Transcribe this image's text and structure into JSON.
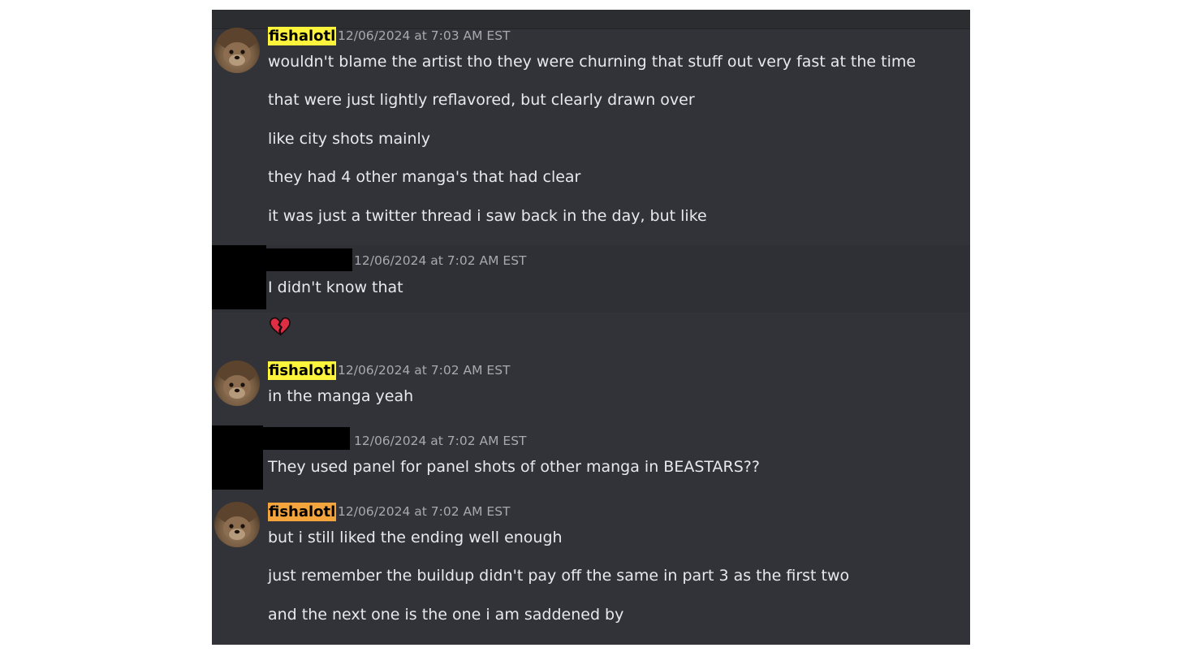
{
  "colors": {
    "background": "#313338",
    "highlight_yellow": "#fdf43b",
    "highlight_orange": "#f4a43c",
    "timestamp": "#a7a9ae",
    "message_text": "#e8e9ec",
    "redaction": "#000000"
  },
  "groups": [
    {
      "author": "fishalotl",
      "timestamp": "12/06/2024 at 7:03 AM EST",
      "messages": [
        "wouldn't blame the artist tho they were churning that stuff out very fast at the time",
        "that were just lightly reflavored, but clearly drawn over",
        "like city shots mainly",
        "they had 4 other manga's that had clear",
        "it was just a twitter thread i saw back in the day, but like"
      ]
    },
    {
      "author": "",
      "timestamp": "12/06/2024 at 7:02 AM EST",
      "messages": [
        "I didn't know that"
      ],
      "reaction": "broken-heart-icon"
    },
    {
      "author": "fishalotl",
      "timestamp": "12/06/2024 at 7:02 AM EST",
      "messages": [
        "in the manga yeah"
      ]
    },
    {
      "author": "",
      "timestamp": "12/06/2024 at 7:02 AM EST",
      "messages": [
        "They used panel for panel shots of other manga in BEASTARS??"
      ]
    },
    {
      "author": "fishalotl",
      "timestamp": "12/06/2024 at 7:02 AM EST",
      "messages": [
        "but i still liked the ending well enough",
        "just remember the buildup didn't pay off the same in part 3 as the first two",
        "and the next one is the one i am saddened by"
      ]
    }
  ]
}
